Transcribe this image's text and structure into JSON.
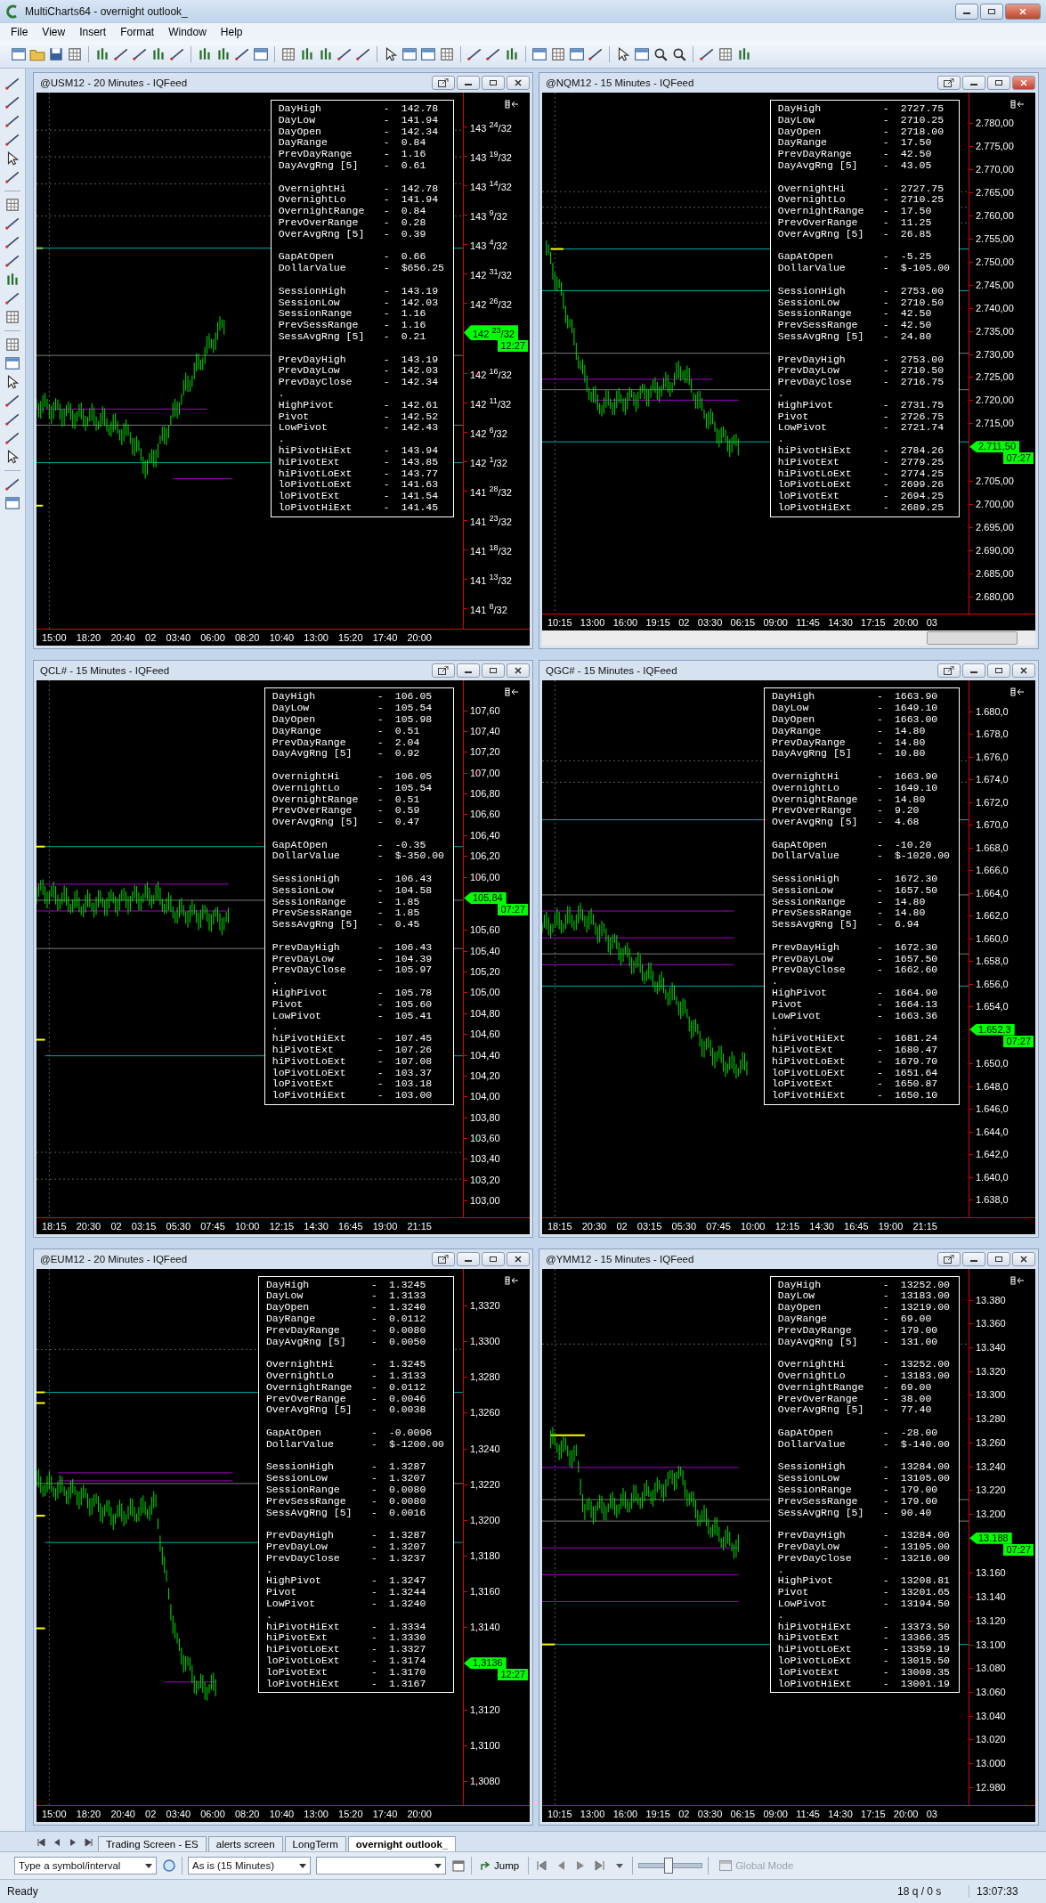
{
  "window": {
    "title": "MultiCharts64 - overnight outlook_"
  },
  "menu": [
    "File",
    "View",
    "Insert",
    "Format",
    "Window",
    "Help"
  ],
  "charts": [
    {
      "title": "@USM12 - 20 Minutes - IQFeed",
      "active": false,
      "scrollbar": false,
      "stats": [
        {
          "rows": [
            [
              "DayHigh",
              "-",
              "142.78"
            ],
            [
              "DayLow",
              "-",
              "141.94"
            ],
            [
              "DayOpen",
              "-",
              "142.34"
            ],
            [
              "DayRange",
              "-",
              "0.84"
            ],
            [
              "PrevDayRange",
              "-",
              "1.16"
            ],
            [
              "DayAvgRng [5]",
              "-",
              "0.61"
            ]
          ]
        },
        {
          "rows": [
            [
              "OvernightHi",
              "-",
              "142.78"
            ],
            [
              "OvernightLo",
              "-",
              "141.94"
            ],
            [
              "OvernightRange",
              "-",
              "0.84"
            ],
            [
              "PrevOverRange",
              "-",
              "0.28"
            ],
            [
              "OverAvgRng [5]",
              "-",
              "0.39"
            ]
          ]
        },
        {
          "rows": [
            [
              "GapAtOpen",
              "-",
              "0.66"
            ],
            [
              "DollarValue",
              "-",
              "$656.25"
            ]
          ]
        },
        {
          "rows": [
            [
              "SessionHigh",
              "-",
              "143.19"
            ],
            [
              "SessionLow",
              "-",
              "142.03"
            ],
            [
              "SessionRange",
              "-",
              "1.16"
            ],
            [
              "PrevSessRange",
              "-",
              "1.16"
            ],
            [
              "SessAvgRng [5]",
              "-",
              "0.21"
            ]
          ]
        },
        {
          "rows": [
            [
              "PrevDayHigh",
              "-",
              "143.19"
            ],
            [
              "PrevDayLow",
              "-",
              "142.03"
            ],
            [
              "PrevDayClose",
              "-",
              "142.34"
            ]
          ]
        },
        {
          "lead": ".",
          "rows": [
            [
              "HighPivot",
              "-",
              "142.61"
            ],
            [
              "Pivot",
              "-",
              "142.52"
            ],
            [
              "LowPivot",
              "-",
              "142.43"
            ]
          ]
        },
        {
          "lead": ".",
          "rows": [
            [
              "hiPivotHiExt",
              "-",
              "143.94"
            ],
            [
              "hiPivotExt",
              "-",
              "143.85"
            ],
            [
              "hiPivotLoExt",
              "-",
              "143.77"
            ],
            [
              "loPivotLoExt",
              "-",
              "141.63"
            ],
            [
              "loPivotExt",
              "-",
              "141.54"
            ],
            [
              "loPivotHiExt",
              "-",
              "141.45"
            ]
          ]
        }
      ],
      "ticks_above": [
        "143 $^{24}$/32",
        "143 $^{19}$/32",
        "143 $^{14}$/32",
        "143 $^{9}$/32",
        "143 $^{4}$/32",
        "142 $^{31}$/32",
        "142 $^{26}$/32"
      ],
      "marker": {
        "price": "142 $^{23}$/32",
        "time": "12:27"
      },
      "ticks_below": [
        "142 $^{16}$/32",
        "142 $^{11}$/32",
        "142 $^{6}$/32",
        "142 $^{1}$/32",
        "141 $^{28}$/32",
        "141 $^{23}$/32",
        "141 $^{18}$/32",
        "141 $^{13}$/32",
        "141 $^{8}$/32"
      ],
      "time_axis": [
        "15:00",
        "18:20",
        "20:40",
        "02",
        "03:40",
        "06:00",
        "08:20",
        "10:40",
        "13:00",
        "15:20",
        "17:40",
        "20:00"
      ]
    },
    {
      "title": "@NQM12 - 15 Minutes - IQFeed",
      "active": true,
      "scrollbar": true,
      "stats": [
        {
          "rows": [
            [
              "DayHigh",
              "-",
              "2727.75"
            ],
            [
              "DayLow",
              "-",
              "2710.25"
            ],
            [
              "DayOpen",
              "-",
              "2718.00"
            ],
            [
              "DayRange",
              "-",
              "17.50"
            ],
            [
              "PrevDayRange",
              "-",
              "42.50"
            ],
            [
              "DayAvgRng [5]",
              "-",
              "43.05"
            ]
          ]
        },
        {
          "rows": [
            [
              "OvernightHi",
              "-",
              "2727.75"
            ],
            [
              "OvernightLo",
              "-",
              "2710.25"
            ],
            [
              "OvernightRange",
              "-",
              "17.50"
            ],
            [
              "PrevOverRange",
              "-",
              "11.25"
            ],
            [
              "OverAvgRng [5]",
              "-",
              "26.85"
            ]
          ]
        },
        {
          "rows": [
            [
              "GapAtOpen",
              "-",
              "-5.25"
            ],
            [
              "DollarValue",
              "-",
              "$-105.00"
            ]
          ]
        },
        {
          "rows": [
            [
              "SessionHigh",
              "-",
              "2753.00"
            ],
            [
              "SessionLow",
              "-",
              "2710.50"
            ],
            [
              "SessionRange",
              "-",
              "42.50"
            ],
            [
              "PrevSessRange",
              "-",
              "42.50"
            ],
            [
              "SessAvgRng [5]",
              "-",
              "24.80"
            ]
          ]
        },
        {
          "rows": [
            [
              "PrevDayHigh",
              "-",
              "2753.00"
            ],
            [
              "PrevDayLow",
              "-",
              "2710.50"
            ],
            [
              "PrevDayClose",
              "-",
              "2716.75"
            ]
          ]
        },
        {
          "lead": ".",
          "rows": [
            [
              "HighPivot",
              "-",
              "2731.75"
            ],
            [
              "Pivot",
              "-",
              "2726.75"
            ],
            [
              "LowPivot",
              "-",
              "2721.74"
            ]
          ]
        },
        {
          "lead": ".",
          "rows": [
            [
              "hiPivotHiExt",
              "-",
              "2784.26"
            ],
            [
              "hiPivotExt",
              "-",
              "2779.25"
            ],
            [
              "hiPivotLoExt",
              "-",
              "2774.25"
            ],
            [
              "loPivotLoExt",
              "-",
              "2699.26"
            ],
            [
              "loPivotExt",
              "-",
              "2694.25"
            ],
            [
              "loPivotHiExt",
              "-",
              "2689.25"
            ]
          ]
        }
      ],
      "ticks_above": [
        "2.780,00",
        "2.775,00",
        "2.770,00",
        "2.765,00",
        "2.760,00",
        "2.755,00",
        "2.750,00",
        "2.745,00",
        "2.740,00",
        "2.735,00",
        "2.730,00",
        "2.725,00",
        "2.720,00",
        "2.715,00"
      ],
      "marker": {
        "price": "2.711,50",
        "time": "07:27"
      },
      "ticks_below": [
        "2.705,00",
        "2.700,00",
        "2.695,00",
        "2.690,00",
        "2.685,00",
        "2.680,00"
      ],
      "time_axis": [
        "10:15",
        "13:00",
        "16:00",
        "19:15",
        "02",
        "03:30",
        "06:15",
        "09:00",
        "11:45",
        "14:30",
        "17:15",
        "20:00",
        "03"
      ]
    },
    {
      "title": "QCL# - 15 Minutes - IQFeed",
      "active": false,
      "scrollbar": false,
      "stats": [
        {
          "rows": [
            [
              "DayHigh",
              "-",
              "106.05"
            ],
            [
              "DayLow",
              "-",
              "105.54"
            ],
            [
              "DayOpen",
              "-",
              "105.98"
            ],
            [
              "DayRange",
              "-",
              "0.51"
            ],
            [
              "PrevDayRange",
              "-",
              "2.04"
            ],
            [
              "DayAvgRng [5]",
              "-",
              "0.92"
            ]
          ]
        },
        {
          "rows": [
            [
              "OvernightHi",
              "-",
              "106.05"
            ],
            [
              "OvernightLo",
              "-",
              "105.54"
            ],
            [
              "OvernightRange",
              "-",
              "0.51"
            ],
            [
              "PrevOverRange",
              "-",
              "0.59"
            ],
            [
              "OverAvgRng [5]",
              "-",
              "0.47"
            ]
          ]
        },
        {
          "rows": [
            [
              "GapAtOpen",
              "-",
              "-0.35"
            ],
            [
              "DollarValue",
              "-",
              "$-350.00"
            ]
          ]
        },
        {
          "rows": [
            [
              "SessionHigh",
              "-",
              "106.43"
            ],
            [
              "SessionLow",
              "-",
              "104.58"
            ],
            [
              "SessionRange",
              "-",
              "1.85"
            ],
            [
              "PrevSessRange",
              "-",
              "1.85"
            ],
            [
              "SessAvgRng [5]",
              "-",
              "0.45"
            ]
          ]
        },
        {
          "rows": [
            [
              "PrevDayHigh",
              "-",
              "106.43"
            ],
            [
              "PrevDayLow",
              "-",
              "104.39"
            ],
            [
              "PrevDayClose",
              "-",
              "105.97"
            ]
          ]
        },
        {
          "lead": ".",
          "rows": [
            [
              "HighPivot",
              "-",
              "105.78"
            ],
            [
              "Pivot",
              "-",
              "105.60"
            ],
            [
              "LowPivot",
              "-",
              "105.41"
            ]
          ]
        },
        {
          "lead": ".",
          "rows": [
            [
              "hiPivotHiExt",
              "-",
              "107.45"
            ],
            [
              "hiPivotExt",
              "-",
              "107.26"
            ],
            [
              "hiPivotLoExt",
              "-",
              "107.08"
            ],
            [
              "loPivotLoExt",
              "-",
              "103.37"
            ],
            [
              "loPivotExt",
              "-",
              "103.18"
            ],
            [
              "loPivotHiExt",
              "-",
              "103.00"
            ]
          ]
        }
      ],
      "ticks_above": [
        "107,60",
        "107,40",
        "107,20",
        "107,00",
        "106,80",
        "106,60",
        "106,40",
        "106,20",
        "106,00"
      ],
      "marker": {
        "price": "105,84",
        "time": "07:27"
      },
      "ticks_below": [
        "105,60",
        "105,40",
        "105,20",
        "105,00",
        "104,80",
        "104,60",
        "104,40",
        "104,20",
        "104,00",
        "103,80",
        "103,60",
        "103,40",
        "103,20",
        "103,00"
      ],
      "time_axis": [
        "18:15",
        "20:30",
        "02",
        "03:15",
        "05:30",
        "07:45",
        "10:00",
        "12:15",
        "14:30",
        "16:45",
        "19:00",
        "21:15"
      ]
    },
    {
      "title": "QGC# - 15 Minutes - IQFeed",
      "active": false,
      "scrollbar": false,
      "stats": [
        {
          "rows": [
            [
              "DayHigh",
              "-",
              "1663.90"
            ],
            [
              "DayLow",
              "-",
              "1649.10"
            ],
            [
              "DayOpen",
              "-",
              "1663.00"
            ],
            [
              "DayRange",
              "-",
              "14.80"
            ],
            [
              "PrevDayRange",
              "-",
              "14.80"
            ],
            [
              "DayAvgRng [5]",
              "-",
              "10.80"
            ]
          ]
        },
        {
          "rows": [
            [
              "OvernightHi",
              "-",
              "1663.90"
            ],
            [
              "OvernightLo",
              "-",
              "1649.10"
            ],
            [
              "OvernightRange",
              "-",
              "14.80"
            ],
            [
              "PrevOverRange",
              "-",
              "9.20"
            ],
            [
              "OverAvgRng [5]",
              "-",
              "4.68"
            ]
          ]
        },
        {
          "rows": [
            [
              "GapAtOpen",
              "-",
              "-10.20"
            ],
            [
              "DollarValue",
              "-",
              "$-1020.00"
            ]
          ]
        },
        {
          "rows": [
            [
              "SessionHigh",
              "-",
              "1672.30"
            ],
            [
              "SessionLow",
              "-",
              "1657.50"
            ],
            [
              "SessionRange",
              "-",
              "14.80"
            ],
            [
              "PrevSessRange",
              "-",
              "14.80"
            ],
            [
              "SessAvgRng [5]",
              "-",
              "6.94"
            ]
          ]
        },
        {
          "rows": [
            [
              "PrevDayHigh",
              "-",
              "1672.30"
            ],
            [
              "PrevDayLow",
              "-",
              "1657.50"
            ],
            [
              "PrevDayClose",
              "-",
              "1662.60"
            ]
          ]
        },
        {
          "lead": ".",
          "rows": [
            [
              "HighPivot",
              "-",
              "1664.90"
            ],
            [
              "Pivot",
              "-",
              "1664.13"
            ],
            [
              "LowPivot",
              "-",
              "1663.36"
            ]
          ]
        },
        {
          "lead": ".",
          "rows": [
            [
              "hiPivotHiExt",
              "-",
              "1681.24"
            ],
            [
              "hiPivotExt",
              "-",
              "1680.47"
            ],
            [
              "hiPivotLoExt",
              "-",
              "1679.70"
            ],
            [
              "loPivotLoExt",
              "-",
              "1651.64"
            ],
            [
              "loPivotExt",
              "-",
              "1650.87"
            ],
            [
              "loPivotHiExt",
              "-",
              "1650.10"
            ]
          ]
        }
      ],
      "ticks_above": [
        "1.680,0",
        "1.678,0",
        "1.676,0",
        "1.674,0",
        "1.672,0",
        "1.670,0",
        "1.668,0",
        "1.666,0",
        "1.664,0",
        "1.662,0",
        "1.660,0",
        "1.658,0",
        "1.656,0",
        "1.654,0"
      ],
      "marker": {
        "price": "1.652,3",
        "time": "07:27"
      },
      "ticks_below": [
        "1.650,0",
        "1.648,0",
        "1.646,0",
        "1.644,0",
        "1.642,0",
        "1.640,0",
        "1.638,0"
      ],
      "time_axis": [
        "18:15",
        "20:30",
        "02",
        "03:15",
        "05:30",
        "07:45",
        "10:00",
        "12:15",
        "14:30",
        "16:45",
        "19:00",
        "21:15"
      ]
    },
    {
      "title": "@EUM12 - 20 Minutes - IQFeed",
      "active": false,
      "scrollbar": false,
      "stats": [
        {
          "rows": [
            [
              "DayHigh",
              "-",
              "1.3245"
            ],
            [
              "DayLow",
              "-",
              "1.3133"
            ],
            [
              "DayOpen",
              "-",
              "1.3240"
            ],
            [
              "DayRange",
              "-",
              "0.0112"
            ],
            [
              "PrevDayRange",
              "-",
              "0.0080"
            ],
            [
              "DayAvgRng [5]",
              "-",
              "0.0050"
            ]
          ]
        },
        {
          "rows": [
            [
              "OvernightHi",
              "-",
              "1.3245"
            ],
            [
              "OvernightLo",
              "-",
              "1.3133"
            ],
            [
              "OvernightRange",
              "-",
              "0.0112"
            ],
            [
              "PrevOverRange",
              "-",
              "0.0046"
            ],
            [
              "OverAvgRng [5]",
              "-",
              "0.0038"
            ]
          ]
        },
        {
          "rows": [
            [
              "GapAtOpen",
              "-",
              "-0.0096"
            ],
            [
              "DollarValue",
              "-",
              "$-1200.00"
            ]
          ]
        },
        {
          "rows": [
            [
              "SessionHigh",
              "-",
              "1.3287"
            ],
            [
              "SessionLow",
              "-",
              "1.3207"
            ],
            [
              "SessionRange",
              "-",
              "0.0080"
            ],
            [
              "PrevSessRange",
              "-",
              "0.0080"
            ],
            [
              "SessAvgRng [5]",
              "-",
              "0.0016"
            ]
          ]
        },
        {
          "rows": [
            [
              "PrevDayHigh",
              "-",
              "1.3287"
            ],
            [
              "PrevDayLow",
              "-",
              "1.3207"
            ],
            [
              "PrevDayClose",
              "-",
              "1.3237"
            ]
          ]
        },
        {
          "lead": ".",
          "rows": [
            [
              "HighPivot",
              "-",
              "1.3247"
            ],
            [
              "Pivot",
              "-",
              "1.3244"
            ],
            [
              "LowPivot",
              "-",
              "1.3240"
            ]
          ]
        },
        {
          "lead": ".",
          "rows": [
            [
              "hiPivotHiExt",
              "-",
              "1.3334"
            ],
            [
              "hiPivotExt",
              "-",
              "1.3330"
            ],
            [
              "hiPivotLoExt",
              "-",
              "1.3327"
            ],
            [
              "loPivotLoExt",
              "-",
              "1.3174"
            ],
            [
              "loPivotExt",
              "-",
              "1.3170"
            ],
            [
              "loPivotHiExt",
              "-",
              "1.3167"
            ]
          ]
        }
      ],
      "ticks_above": [
        "1,3320",
        "1,3300",
        "1,3280",
        "1,3260",
        "1,3240",
        "1,3220",
        "1,3200",
        "1,3180",
        "1,3160",
        "1,3140"
      ],
      "marker": {
        "price": "1,3136",
        "time": "12:27"
      },
      "ticks_below": [
        "1,3120",
        "1,3100",
        "1,3080"
      ],
      "time_axis": [
        "15:00",
        "18:20",
        "20:40",
        "02",
        "03:40",
        "06:00",
        "08:20",
        "10:40",
        "13:00",
        "15:20",
        "17:40",
        "20:00"
      ]
    },
    {
      "title": "@YMM12 - 15 Minutes - IQFeed",
      "active": false,
      "scrollbar": false,
      "stats": [
        {
          "rows": [
            [
              "DayHigh",
              "-",
              "13252.00"
            ],
            [
              "DayLow",
              "-",
              "13183.00"
            ],
            [
              "DayOpen",
              "-",
              "13219.00"
            ],
            [
              "DayRange",
              "-",
              "69.00"
            ],
            [
              "PrevDayRange",
              "-",
              "179.00"
            ],
            [
              "DayAvgRng [5]",
              "-",
              "131.00"
            ]
          ]
        },
        {
          "rows": [
            [
              "OvernightHi",
              "-",
              "13252.00"
            ],
            [
              "OvernightLo",
              "-",
              "13183.00"
            ],
            [
              "OvernightRange",
              "-",
              "69.00"
            ],
            [
              "PrevOverRange",
              "-",
              "38.00"
            ],
            [
              "OverAvgRng [5]",
              "-",
              "77.40"
            ]
          ]
        },
        {
          "rows": [
            [
              "GapAtOpen",
              "-",
              "-28.00"
            ],
            [
              "DollarValue",
              "-",
              "$-140.00"
            ]
          ]
        },
        {
          "rows": [
            [
              "SessionHigh",
              "-",
              "13284.00"
            ],
            [
              "SessionLow",
              "-",
              "13105.00"
            ],
            [
              "SessionRange",
              "-",
              "179.00"
            ],
            [
              "PrevSessRange",
              "-",
              "179.00"
            ],
            [
              "SessAvgRng [5]",
              "-",
              "90.40"
            ]
          ]
        },
        {
          "rows": [
            [
              "PrevDayHigh",
              "-",
              "13284.00"
            ],
            [
              "PrevDayLow",
              "-",
              "13105.00"
            ],
            [
              "PrevDayClose",
              "-",
              "13216.00"
            ]
          ]
        },
        {
          "lead": ".",
          "rows": [
            [
              "HighPivot",
              "-",
              "13208.81"
            ],
            [
              "Pivot",
              "-",
              "13201.65"
            ],
            [
              "LowPivot",
              "-",
              "13194.50"
            ]
          ]
        },
        {
          "lead": ".",
          "rows": [
            [
              "hiPivotHiExt",
              "-",
              "13373.50"
            ],
            [
              "hiPivotExt",
              "-",
              "13366.35"
            ],
            [
              "hiPivotLoExt",
              "-",
              "13359.19"
            ],
            [
              "loPivotLoExt",
              "-",
              "13015.50"
            ],
            [
              "loPivotExt",
              "-",
              "13008.35"
            ],
            [
              "loPivotHiExt",
              "-",
              "13001.19"
            ]
          ]
        }
      ],
      "ticks_above": [
        "13.380",
        "13.360",
        "13.340",
        "13.320",
        "13.300",
        "13.280",
        "13.260",
        "13.240",
        "13.220",
        "13.200"
      ],
      "marker": {
        "price": "13.188",
        "time": "07:27"
      },
      "ticks_below": [
        "13.160",
        "13.140",
        "13.120",
        "13.100",
        "13.080",
        "13.060",
        "13.040",
        "13.020",
        "13.000",
        "12.980"
      ],
      "time_axis": [
        "10:15",
        "13:00",
        "16:00",
        "19:15",
        "02",
        "03:30",
        "06:15",
        "09:00",
        "11:45",
        "14:30",
        "17:15",
        "20:00",
        "03"
      ]
    }
  ],
  "tabs": [
    {
      "label": "Trading Screen - ES",
      "selected": false
    },
    {
      "label": "alerts screen",
      "selected": false
    },
    {
      "label": "LongTerm",
      "selected": false
    },
    {
      "label": "overnight outlook_",
      "selected": true
    }
  ],
  "symbol_field": {
    "placeholder": "Type a symbol/interval"
  },
  "interval_dropdown": {
    "value": "As is (15 Minutes)"
  },
  "jump_button": "Jump",
  "slider": {
    "level": 0.45
  },
  "global_mode": {
    "label": "Global Mode",
    "disabled": true
  },
  "status_bar": {
    "text": "Ready",
    "queue": "18 q / 0 s",
    "clock": "13:07:33"
  }
}
